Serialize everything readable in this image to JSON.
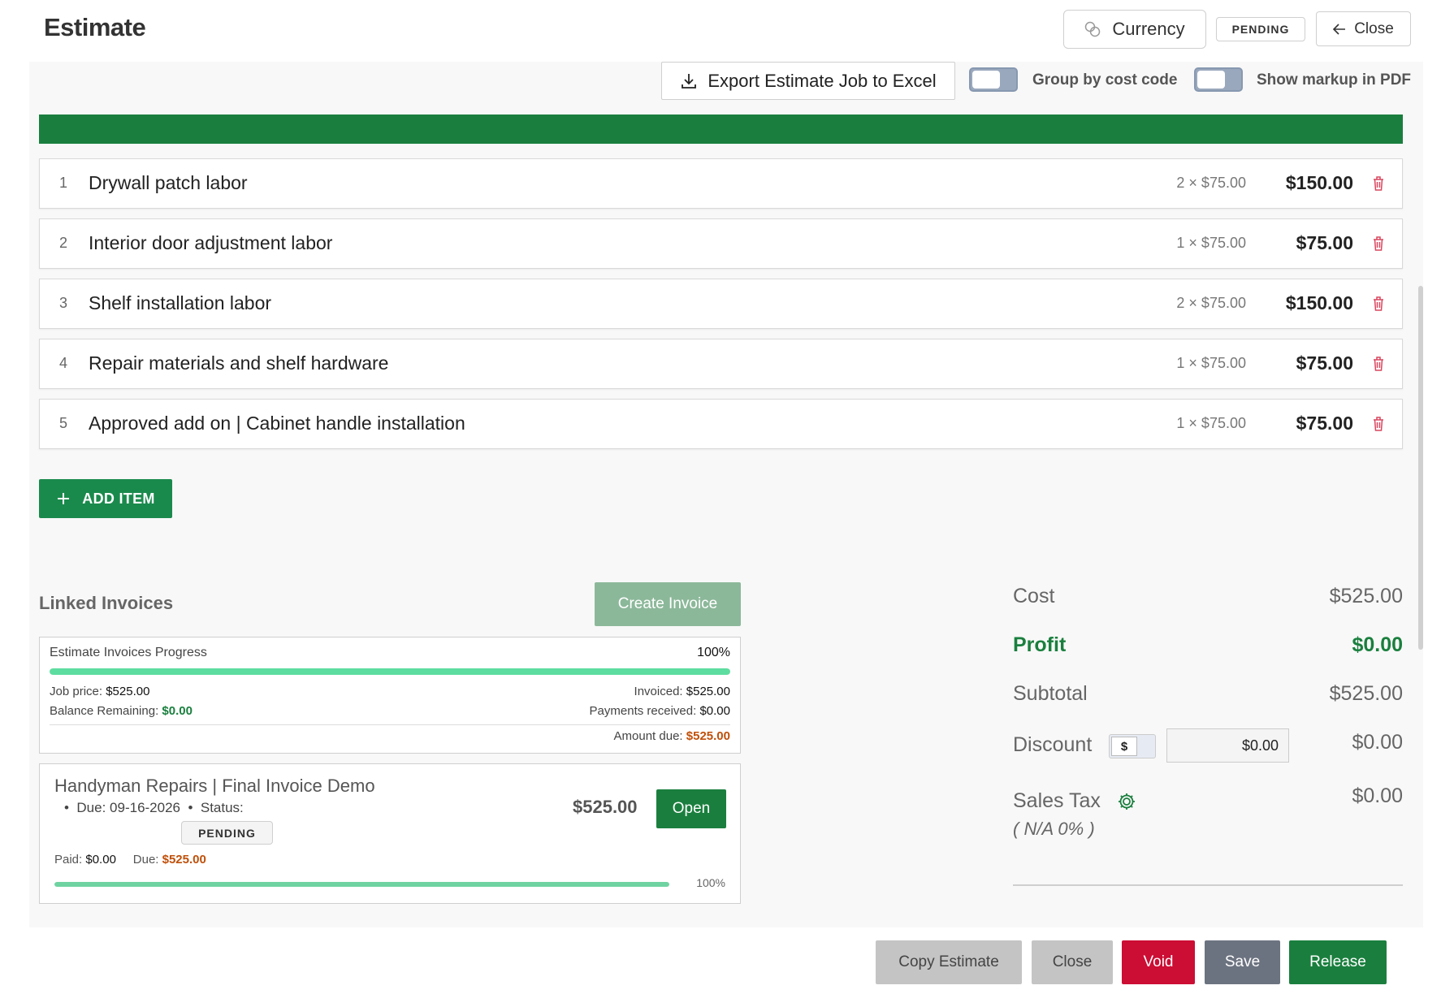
{
  "header": {
    "title": "Estimate",
    "currency_label": "Currency",
    "status": "PENDING",
    "close_label": "Close"
  },
  "toolbar": {
    "export_label": "Export Estimate Job to Excel",
    "group_by_label": "Group by cost code",
    "group_by_on": false,
    "markup_label": "Show markup in PDF",
    "markup_on": false
  },
  "items": [
    {
      "num": "1",
      "desc": "Drywall patch labor",
      "qty": "2 × $75.00",
      "total": "$150.00"
    },
    {
      "num": "2",
      "desc": "Interior door adjustment labor",
      "qty": "1 × $75.00",
      "total": "$75.00"
    },
    {
      "num": "3",
      "desc": "Shelf installation labor",
      "qty": "2 × $75.00",
      "total": "$150.00"
    },
    {
      "num": "4",
      "desc": "Repair materials and shelf hardware",
      "qty": "1 × $75.00",
      "total": "$75.00"
    },
    {
      "num": "5",
      "desc": "Approved add on | Cabinet handle installation",
      "qty": "1 × $75.00",
      "total": "$75.00"
    }
  ],
  "add_item_label": "ADD ITEM",
  "linked": {
    "title": "Linked Invoices",
    "create_label": "Create Invoice",
    "progress": {
      "title": "Estimate Invoices Progress",
      "percent_text": "100%",
      "percent_value": 100,
      "job_price_label": "Job price:",
      "job_price": "$525.00",
      "balance_label": "Balance Remaining:",
      "balance": "$0.00",
      "invoiced_label": "Invoiced:",
      "invoiced": "$525.00",
      "payments_label": "Payments received:",
      "payments": "$0.00",
      "amount_due_label": "Amount due:",
      "amount_due": "$525.00"
    },
    "invoice": {
      "title": "Handyman Repairs | Final Invoice Demo",
      "due_text": "Due: 09-16-2026",
      "status_label": "Status:",
      "status": "PENDING",
      "amount": "$525.00",
      "open_label": "Open",
      "paid_label": "Paid:",
      "paid": "$0.00",
      "due_label": "Due:",
      "due": "$525.00",
      "percent_text": "100%",
      "percent_value": 100
    }
  },
  "summary": {
    "cost_label": "Cost",
    "cost": "$525.00",
    "profit_label": "Profit",
    "profit": "$0.00",
    "subtotal_label": "Subtotal",
    "subtotal": "$525.00",
    "discount_label": "Discount",
    "discount_mode": "$",
    "discount_input": "$0.00",
    "discount": "$0.00",
    "tax_label": "Sales Tax",
    "tax_note": "( N/A 0% )",
    "tax": "$0.00"
  },
  "footer": {
    "copy_label": "Copy Estimate",
    "close_label": "Close",
    "void_label": "Void",
    "save_label": "Save",
    "release_label": "Release"
  },
  "colors": {
    "brand_green": "#1a7f3e",
    "progress_fill": "#5edda0",
    "invoice_fill": "#6fd3a1",
    "danger": "#cc0d34",
    "due_orange": "#c0500a"
  }
}
